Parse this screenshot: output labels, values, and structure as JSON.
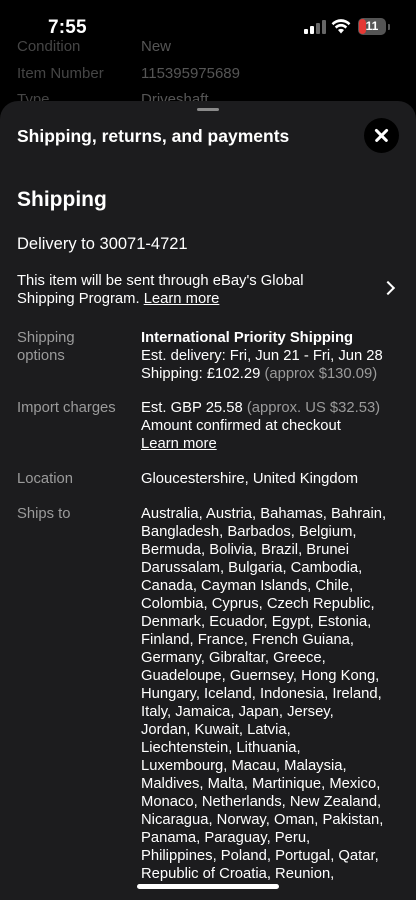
{
  "status_bar": {
    "time": "7:55",
    "battery_level": "11",
    "battery_color": "#e53935"
  },
  "background_listing": {
    "rows": [
      {
        "label": "Condition",
        "value": "New"
      },
      {
        "label": "Item Number",
        "value": "115395975689"
      },
      {
        "label": "Type",
        "value": "Driveshaft"
      }
    ]
  },
  "sheet": {
    "title": "Shipping, returns, and payments",
    "section_title": "Shipping",
    "delivery_to": "Delivery to 30071-4721",
    "gsp": {
      "text": "This item will be sent through eBay's Global Shipping Program.",
      "link": "Learn more"
    },
    "shipping_options": {
      "label_line1": "Shipping",
      "label_line2": "options",
      "service": "International Priority Shipping",
      "est_delivery": "Est. delivery: Fri, Jun 21 - Fri, Jun 28",
      "cost": "Shipping: £102.29",
      "cost_approx": "(approx $130.09)"
    },
    "import_charges": {
      "label": "Import charges",
      "amount": "Est. GBP 25.58",
      "amount_approx": "(approx. US $32.53)",
      "note": "Amount confirmed at checkout",
      "link": "Learn more"
    },
    "location": {
      "label": "Location",
      "value": "Gloucestershire, United Kingdom"
    },
    "ships_to": {
      "label": "Ships to",
      "lines": [
        "Australia, Austria, Bahamas, Bahrain,",
        "Bangladesh, Barbados, Belgium,",
        "Bermuda, Bolivia, Brazil, Brunei",
        "Darussalam, Bulgaria, Cambodia,",
        "Canada, Cayman Islands, Chile,",
        "Colombia, Cyprus, Czech Republic,",
        "Denmark, Ecuador, Egypt, Estonia,",
        "Finland, France, French Guiana,",
        "Germany, Gibraltar, Greece,",
        "Guadeloupe, Guernsey, Hong Kong,",
        "Hungary, Iceland, Indonesia, Ireland,",
        "Italy, Jamaica, Japan, Jersey,",
        "Jordan, Kuwait, Latvia,",
        "Liechtenstein, Lithuania,",
        "Luxembourg, Macau, Malaysia,",
        "Maldives, Malta, Martinique, Mexico,",
        "Monaco, Netherlands, New Zealand,",
        "Nicaragua, Norway, Oman, Pakistan,",
        "Panama, Paraguay, Peru,",
        "Philippines, Poland, Portugal, Qatar,",
        "Republic of Croatia, Reunion,"
      ]
    }
  }
}
